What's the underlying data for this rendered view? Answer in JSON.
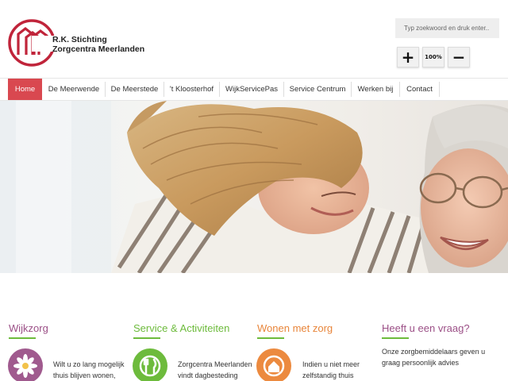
{
  "brand": {
    "line1": "R.K. Stichting",
    "line2": "Zorgcentra Meerlanden"
  },
  "search": {
    "placeholder": "Typ zoekwoord en druk enter.."
  },
  "zoom": {
    "in_icon": "plus-icon",
    "in_symbol": "+",
    "reset_label": "100%",
    "out_icon": "minus-icon",
    "out_symbol": "−"
  },
  "nav": {
    "items": [
      {
        "label": "Home",
        "active": true
      },
      {
        "label": "De Meerwende"
      },
      {
        "label": "De Meerstede"
      },
      {
        "label": "'t Kloosterhof"
      },
      {
        "label": "WijkServicePas"
      },
      {
        "label": "Service Centrum"
      },
      {
        "label": "Werken bij"
      },
      {
        "label": "Contact"
      }
    ]
  },
  "columns": [
    {
      "title": "Wijkzorg",
      "title_color": "#9b4f86",
      "icon": "flower-icon",
      "icon_color": "#a05a8e",
      "text": [
        "Wilt u zo lang mogelijk",
        "thuis blijven wonen,"
      ]
    },
    {
      "title": "Service & Activiteiten",
      "title_color": "#6dbb3c",
      "icon": "fork-knife-icon",
      "icon_color": "#6dbb3c",
      "text": [
        "Zorgcentra Meerlanden",
        "vindt dagbesteding"
      ]
    },
    {
      "title": "Wonen met zorg",
      "title_color": "#e8853a",
      "icon": "house-icon",
      "icon_color": "#ec8a3f",
      "text": [
        "Indien u niet meer",
        "zelfstandig thuis"
      ]
    },
    {
      "title": "Heeft u een vraag?",
      "title_color": "#9b4f86",
      "text": [
        "Onze zorgbemiddelaars geven u",
        "graag persoonlijk advies"
      ]
    }
  ],
  "colors": {
    "accent": "#d94850",
    "green": "#6dbb3c",
    "purple": "#9b4f86",
    "orange": "#e8853a"
  }
}
